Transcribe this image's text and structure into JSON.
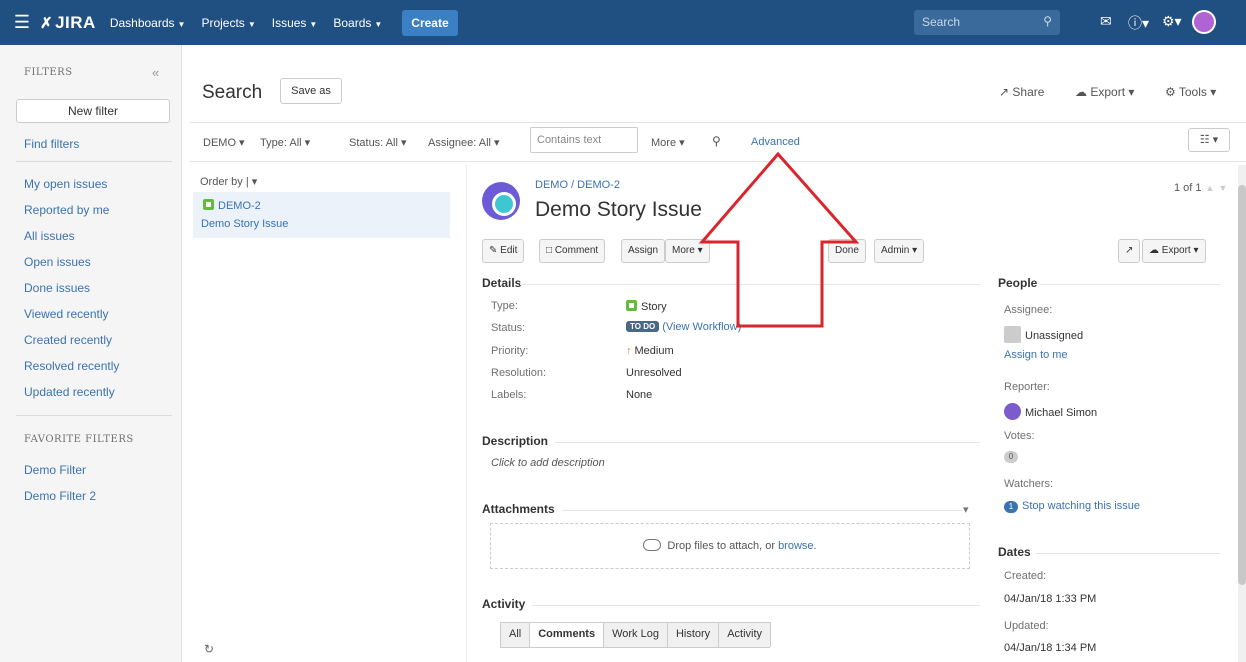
{
  "topnav": {
    "logo": "JIRA",
    "menu": [
      "Dashboards",
      "Projects",
      "Issues",
      "Boards"
    ],
    "create_label": "Create",
    "search_placeholder": "Search"
  },
  "sidebar": {
    "filters_header": "FILTERS",
    "new_filter_label": "New filter",
    "find_filters": "Find filters",
    "links": [
      "My open issues",
      "Reported by me",
      "All issues",
      "Open issues",
      "Done issues",
      "Viewed recently",
      "Created recently",
      "Resolved recently",
      "Updated recently"
    ],
    "favorites_header": "FAVORITE FILTERS",
    "favorites": [
      "Demo Filter",
      "Demo Filter 2"
    ]
  },
  "header": {
    "title": "Search",
    "save_as": "Save as",
    "share": "Share",
    "export": "Export",
    "tools": "Tools"
  },
  "filterbar": {
    "project": "DEMO",
    "type": "Type: All",
    "status": "Status: All",
    "assignee": "Assignee: All",
    "text_placeholder": "Contains text",
    "more": "More",
    "advanced": "Advanced"
  },
  "list": {
    "order_by": "Order by",
    "items": [
      {
        "key": "DEMO-2",
        "summary": "Demo Story Issue"
      }
    ]
  },
  "issue": {
    "project": "DEMO",
    "key": "DEMO-2",
    "title": "Demo Story Issue",
    "pager": "1 of 1",
    "ops": {
      "edit": "Edit",
      "comment": "Comment",
      "assign": "Assign",
      "more": "More",
      "done": "Done",
      "admin": "Admin",
      "export": "Export"
    },
    "details_header": "Details",
    "details": [
      {
        "label": "Type:",
        "value": "Story"
      },
      {
        "label": "Status:",
        "value": "TO DO",
        "link": "(View Workflow)"
      },
      {
        "label": "Priority:",
        "value": "Medium"
      },
      {
        "label": "Resolution:",
        "value": "Unresolved"
      },
      {
        "label": "Labels:",
        "value": "None"
      }
    ],
    "description_header": "Description",
    "description_placeholder": "Click to add description",
    "attachments_header": "Attachments",
    "drop_text": "Drop files to attach, or",
    "browse": "browse.",
    "activity_header": "Activity",
    "activity_tabs": [
      "All",
      "Comments",
      "Work Log",
      "History",
      "Activity"
    ]
  },
  "people": {
    "header": "People",
    "assignee_label": "Assignee:",
    "assignee": "Unassigned",
    "assign_to_me": "Assign to me",
    "reporter_label": "Reporter:",
    "reporter": "Michael Simon",
    "votes_label": "Votes:",
    "votes": "0",
    "watchers_label": "Watchers:",
    "watchers_count": "1",
    "watch_link": "Stop watching this issue"
  },
  "dates": {
    "header": "Dates",
    "created_label": "Created:",
    "created": "04/Jan/18 1:33 PM",
    "updated_label": "Updated:",
    "updated": "04/Jan/18 1:34 PM"
  },
  "colors": {
    "nav": "#205081",
    "link": "#3b73af",
    "annotation": "#d9262c"
  }
}
